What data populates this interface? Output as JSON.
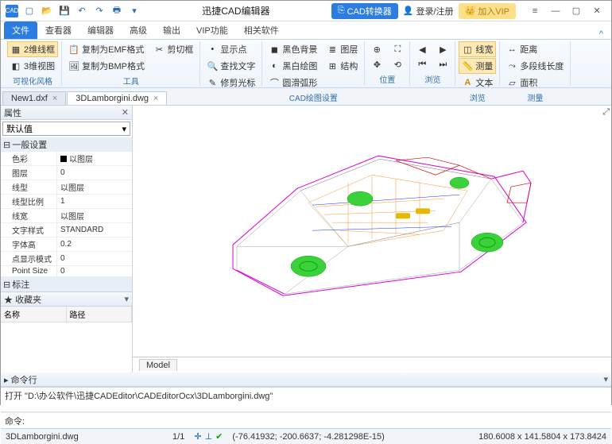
{
  "title": "迅捷CAD编辑器",
  "title_buttons": {
    "cad_conv": "CAD转换器",
    "login": "登录/注册",
    "vip": "加入VIP"
  },
  "ribbon_tabs": [
    "文件",
    "查看器",
    "编辑器",
    "高级",
    "输出",
    "VIP功能",
    "相关软件"
  ],
  "ribbon_groups": {
    "group1": {
      "wire2d": "2维线框",
      "view3d": "3维视图",
      "name": "可视化风格"
    },
    "group2": {
      "copy_emf": "复制为EMF格式",
      "copy_bmp": "复制为BMP格式",
      "cut": "剪切框",
      "name": "工具"
    },
    "group3": {
      "show_pt": "显示点",
      "find_text": "查找文字",
      "repair_cursor": "修剪光标"
    },
    "group4": {
      "black_bg": "黑色背景",
      "bw_draw": "黑白绘图",
      "arc": "圆滑弧形",
      "name": "CAD绘图设置"
    },
    "group5": {
      "layer": "图层",
      "struct": "结构"
    },
    "group6": {
      "name": "位置"
    },
    "group7": {
      "name": "浏览"
    },
    "group8": {
      "linewidth": "线宽",
      "measure": "测量",
      "text": "文本",
      "name": "浏览"
    },
    "group9": {
      "distance": "距离",
      "multiline": "多段线长度",
      "area": "面积",
      "name": "测量"
    }
  },
  "doc_tabs": [
    "New1.dxf",
    "3DLamborgini.dwg"
  ],
  "panels": {
    "prop_title": "属性",
    "prop_combo": "默认值",
    "cat_general": "一般设置",
    "rows": [
      {
        "k": "色彩",
        "v": "以图层",
        "swatch": true
      },
      {
        "k": "图层",
        "v": "0"
      },
      {
        "k": "线型",
        "v": "以图层"
      },
      {
        "k": "线型比例",
        "v": "1"
      },
      {
        "k": "线宽",
        "v": "以图层"
      },
      {
        "k": "文字样式",
        "v": "STANDARD"
      },
      {
        "k": "字体高",
        "v": "0.2"
      },
      {
        "k": "点显示模式",
        "v": "0"
      },
      {
        "k": "Point Size",
        "v": "0"
      }
    ],
    "cat_marker": "标注",
    "fav_title": "收藏夹",
    "fav_col1": "名称",
    "fav_col2": "路径"
  },
  "model_tab": "Model",
  "cmd": {
    "title": "命令行",
    "log": "打开 \"D:\\办公软件\\迅捷CADEditor\\CADEditorOcx\\3DLamborgini.dwg\"",
    "prompt": "命令:"
  },
  "status": {
    "file": "3DLamborgini.dwg",
    "pages": "1/1",
    "coords": "(-76.41932; -200.6637; -4.281298E-15)",
    "box": "180.6008 x 141.5804 x 173.8424"
  }
}
